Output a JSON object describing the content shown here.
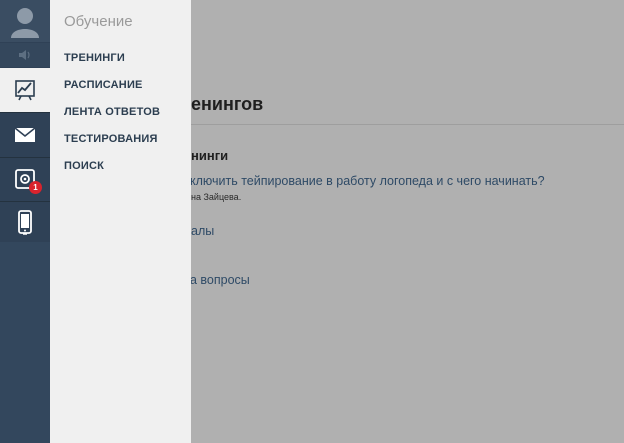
{
  "flyout": {
    "title": "Обучение",
    "items": [
      "ТРЕНИНГИ",
      "РАСПИСАНИЕ",
      "ЛЕНТА ОТВЕТОВ",
      "ТЕСТИРОВАНИЯ",
      "ПОИСК"
    ]
  },
  "rail": {
    "icons": [
      "avatar-icon",
      "speaker-icon",
      "chart-icon",
      "mail-icon",
      "safe-icon",
      "phone-icon"
    ],
    "badge_count": "1"
  },
  "background": {
    "heading": "енингов",
    "subheading": "нинги",
    "training_link": "ключить тейпирование в работу логопеда и с чего начинать?",
    "author": "на Зайцева.",
    "link2": "алы",
    "link3": "а вопросы"
  },
  "colors": {
    "rail": "#2f4156",
    "flyout": "#f0f0f0",
    "overlay": "#b0b0b0",
    "badge": "#d9232d"
  }
}
